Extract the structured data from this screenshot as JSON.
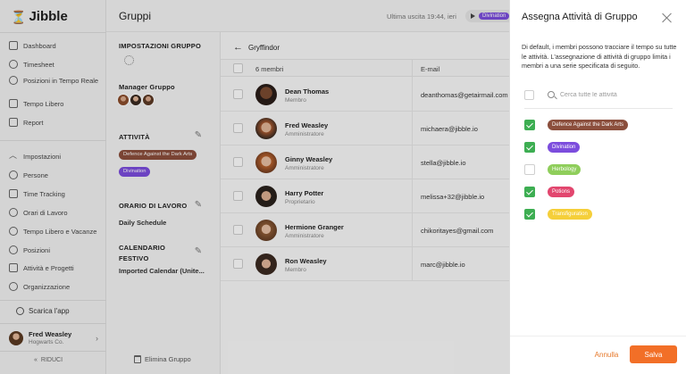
{
  "app": {
    "logo_text": "Jibble",
    "logo_mark": "⏳"
  },
  "sidebar": {
    "nav_top": [
      {
        "label": "Dashboard",
        "icon": "grid-icon"
      },
      {
        "label": "Timesheet",
        "icon": "clock-icon"
      },
      {
        "label": "Posizioni in Tempo Reale",
        "icon": "location-icon"
      },
      {
        "label": "Tempo Libero",
        "icon": "calendar-icon"
      },
      {
        "label": "Report",
        "icon": "report-icon"
      }
    ],
    "nav_settings": [
      {
        "label": "Impostazioni",
        "icon": "chevron-up-icon"
      },
      {
        "label": "Persone",
        "icon": "people-icon"
      },
      {
        "label": "Time Tracking",
        "icon": "time-tracking-icon"
      },
      {
        "label": "Orari di Lavoro",
        "icon": "work-schedule-icon"
      },
      {
        "label": "Tempo Libero e Vacanze",
        "icon": "vacation-icon"
      },
      {
        "label": "Posizioni",
        "icon": "pin-icon"
      },
      {
        "label": "Attività e Progetti",
        "icon": "tag-icon"
      },
      {
        "label": "Organizzazione",
        "icon": "gear-icon"
      }
    ],
    "download_label": "Scarica l'app",
    "profile": {
      "name": "Fred Weasley",
      "org": "Hogwarts Co."
    },
    "collapse_label": "RIDUCI"
  },
  "topbar": {
    "title": "Gruppi",
    "last_exit": "Ultima uscita 19:44, ieri",
    "timer_tag": "Divination"
  },
  "settings_panel": {
    "section_title": "IMPOSTAZIONI GRUPPO",
    "manager_label": "Manager Gruppo",
    "activities_label": "ATTIVITÀ",
    "activities": [
      {
        "name": "Defence Against the Dark Arts",
        "color": "#8b4e3c"
      },
      {
        "name": "Divination",
        "color": "#7c4ddd"
      }
    ],
    "work_schedule_label": "ORARIO DI LAVORO",
    "work_schedule_value": "Daily Schedule",
    "holiday_label": "CALENDARIO FESTIVO",
    "holiday_value": "Imported Calendar (Unite...",
    "delete_label": "Elimina Gruppo"
  },
  "members": {
    "group_name": "Gryffindor",
    "count_label": "6 membri",
    "email_header": "E-mail",
    "rows": [
      {
        "name": "Dean Thomas",
        "role": "Membro",
        "email": "deanthomas@getairmail.com"
      },
      {
        "name": "Fred Weasley",
        "role": "Amministratore",
        "email": "michaera@jibble.io"
      },
      {
        "name": "Ginny Weasley",
        "role": "Amministratore",
        "email": "stella@jibble.io"
      },
      {
        "name": "Harry Potter",
        "role": "Proprietario",
        "email": "melissa+32@jibble.io"
      },
      {
        "name": "Hermione Granger",
        "role": "Amministratore",
        "email": "chikoritayes@gmail.com"
      },
      {
        "name": "Ron Weasley",
        "role": "Membro",
        "email": "marc@jibble.io"
      }
    ]
  },
  "modal": {
    "title": "Assegna Attività di Gruppo",
    "description": "Di default, i membri possono tracciare il tempo su tutte le attività. L'assegnazione di attività di gruppo limita i membri a una serie specificata di seguito.",
    "search_placeholder": "Cerca tutte le attività",
    "activities": [
      {
        "name": "Defence Against the Dark Arts",
        "color": "#8b4e3c",
        "checked": true
      },
      {
        "name": "Divination",
        "color": "#7c4ddd",
        "checked": true
      },
      {
        "name": "Herbology",
        "color": "#8fce5b",
        "checked": false
      },
      {
        "name": "Potions",
        "color": "#e2466e",
        "checked": true
      },
      {
        "name": "Transfiguration",
        "color": "#f5cf3a",
        "checked": true
      }
    ],
    "cancel_label": "Annulla",
    "save_label": "Salva",
    "accent_color": "#f26f27"
  }
}
